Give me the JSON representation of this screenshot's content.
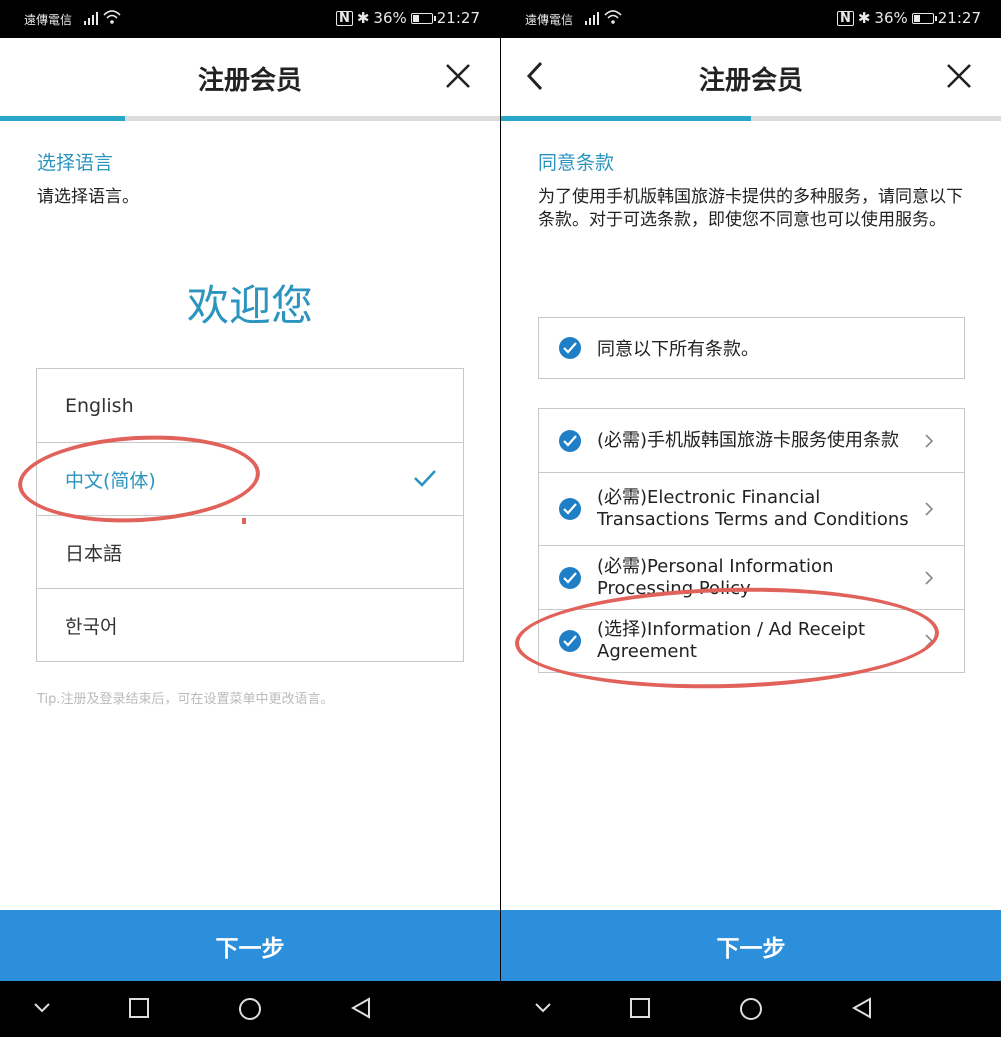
{
  "status_bar": {
    "carrier": "遠傳電信",
    "battery": "36%",
    "time": "21:27",
    "nfc": "N"
  },
  "left": {
    "header_title": "注册会员",
    "progress_fraction": 0.25,
    "section_title": "选择语言",
    "section_desc": "请选择语言。",
    "welcome": "欢迎您",
    "languages": [
      {
        "label": "English",
        "selected": false
      },
      {
        "label": "中文(简体)",
        "selected": true
      },
      {
        "label": "日本語",
        "selected": false
      },
      {
        "label": "한국어",
        "selected": false
      }
    ],
    "tip": "Tip.注册及登录结束后，可在设置菜单中更改语言。",
    "next_label": "下一步"
  },
  "right": {
    "header_title": "注册会员",
    "progress_fraction": 0.5,
    "section_title": "同意条款",
    "section_desc": "为了使用手机版韩国旅游卡提供的多种服务，请同意以下条款。对于可选条款，即使您不同意也可以使用服务。",
    "agree_all": "同意以下所有条款。",
    "terms": [
      {
        "label": "(必需)手机版韩国旅游卡服务使用条款",
        "checked": true
      },
      {
        "label": "(必需)Electronic Financial Transactions Terms and Conditions",
        "checked": true
      },
      {
        "label": "(必需)Personal Information Processing Policy",
        "checked": true
      },
      {
        "label": "(选择)Information / Ad Receipt Agreement",
        "checked": true
      }
    ],
    "next_label": "下一步"
  },
  "colors": {
    "accent": "#2c95bf",
    "button": "#2b8fdb",
    "check": "#1f7fc6",
    "annotation": "#e0625a"
  }
}
